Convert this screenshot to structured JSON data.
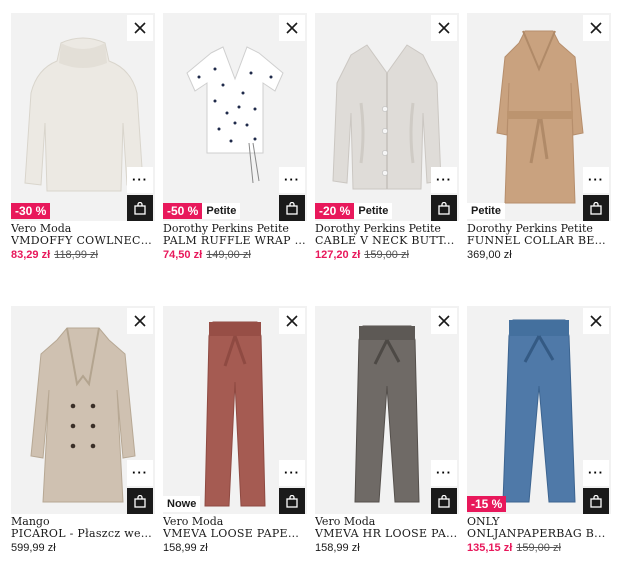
{
  "colors": {
    "sale": "#e8185b",
    "bag": "#1a1a1a"
  },
  "icons": {
    "close": "close-icon",
    "more": "more-dots-icon",
    "bag": "shopping-bag-icon"
  },
  "products": [
    {
      "brand": "Vero Moda",
      "name": "VMDOFFY COWLNECK...",
      "price": "83,29 zł",
      "old_price": "118,99 zł",
      "discount": "-30 %",
      "label": ""
    },
    {
      "brand": "Dorothy Perkins Petite",
      "name": "PALM RUFFLE WRAP - ...",
      "price": "74,50 zł",
      "old_price": "149,00 zł",
      "discount": "-50 %",
      "label": "Petite"
    },
    {
      "brand": "Dorothy Perkins Petite",
      "name": "CABLE V NECK BUTT...",
      "price": "127,20 zł",
      "old_price": "159,00 zł",
      "discount": "-20 %",
      "label": "Petite"
    },
    {
      "brand": "Dorothy Perkins Petite",
      "name": "FUNNEL COLLAR BEL...",
      "price": "369,00 zł",
      "old_price": "",
      "discount": "",
      "label": "Petite"
    },
    {
      "brand": "Mango",
      "name": "PICAROL - Płaszcz weł...",
      "price": "599,99 zł",
      "old_price": "",
      "discount": "",
      "label": ""
    },
    {
      "brand": "Vero Moda",
      "name": "VMEVA LOOSE PAPER...",
      "price": "158,99 zł",
      "old_price": "",
      "discount": "",
      "label": "Nowe"
    },
    {
      "brand": "Vero Moda",
      "name": "VMEVA HR LOOSE PA...",
      "price": "158,99 zł",
      "old_price": "",
      "discount": "",
      "label": ""
    },
    {
      "brand": "ONLY",
      "name": "ONLJANPAPERBAG B...",
      "price": "135,15 zł",
      "old_price": "159,00 zł",
      "discount": "-15 %",
      "label": ""
    }
  ]
}
